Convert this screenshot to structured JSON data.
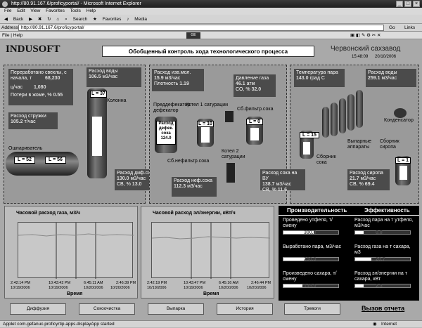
{
  "window": {
    "title": "http://80.91.167.6/proficyportal/ - Microsoft Internet Explorer"
  },
  "menu": [
    "File",
    "Edit",
    "View",
    "Favorites",
    "Tools",
    "Help"
  ],
  "toolbar": {
    "back": "Back",
    "search": "Search",
    "favorites": "Favorites",
    "media": "Media"
  },
  "address": {
    "label": "Address",
    "value": "http://80.91.167.6/proficyportal/",
    "go": "Go",
    "links": "Links"
  },
  "appmenu": {
    "file_help": "File | Help"
  },
  "header": {
    "logo": "INDUSOFT",
    "title": "Обобщенный контроль хода технологического процесса",
    "plant": "Червонский сахзавод",
    "time": "15:48:09",
    "date": "20/10/2006"
  },
  "left_panel": {
    "processed_label": "Переработано свеклы, с начала, т",
    "processed_value": "68,230",
    "perhour_label": "ц/час",
    "perhour_value": "1,080",
    "loss_label": "Потери в жоме, %",
    "loss_value": "0.55",
    "chips_label": "Расход стружки",
    "chips_value": "105.2",
    "chips_unit": "т/час",
    "water_label": "Расход воды",
    "water_value": "106.5",
    "water_unit": "м3/час",
    "column_label": "Колонна",
    "column_level": "L = 37",
    "scalder_label": "Ошпариватель",
    "scalder_l1": "L = 52",
    "scalder_l2": "L = 56",
    "diff_label": "Расход диф.сока",
    "diff_value": "130.0",
    "diff_unit": "м3/час",
    "sv_label": "СВ, %",
    "sv_value": "13.0"
  },
  "mid_panel": {
    "lime_label": "Расход изв.мол.",
    "lime_value": "15.9",
    "lime_unit": "м3/час",
    "density_label": "Плотность",
    "density_value": "1.19",
    "gas_label": "Давление газа",
    "gas_value": "46.1",
    "gas_unit": "атм",
    "co_label": "CO, %",
    "co_value": "32.0",
    "predef_label": "Преддефекатор дефекатор",
    "defek_tank_label": "Расход дефек. сока",
    "defek_tank_value": "124.0",
    "sat1_label": "Котел 1 сатурации",
    "sb_filtr_label": "Сб.фильтр.сока",
    "sb_nefilt_label": "Сб.нефильтр.сока",
    "sat2_label": "Котел 2 сатурации",
    "l10": "L = 10",
    "l0": "L = 0",
    "nef_label": "Расход неф.сока",
    "nef_value": "112.3",
    "nef_unit": "м3/час"
  },
  "right_panel": {
    "steam_temp_label": "Температура пара",
    "steam_temp_value": "143.0",
    "steam_temp_unit": "град С",
    "water2_label": "Расход воды",
    "water2_value": "259.1",
    "water2_unit": "м3/час",
    "condenser_label": "Конденсатор",
    "evap_label": "Выпарные аппараты",
    "sok_label": "Сборник сока",
    "sok_level": "L = 15",
    "syrup_coll_label": "Сборник сиропа",
    "syrup_level": "L = 1",
    "vu_label": "Расход сока на ВУ",
    "vu_value": "138.7",
    "vu_unit": "м3/час",
    "sv2_label": "СВ, %",
    "sv2_value": "11.6",
    "syrup_label": "Расход сиропа",
    "syrup_value": "21.7",
    "syrup_unit": "м3/час",
    "sv3_label": "СВ, %",
    "sv3_value": "69.4"
  },
  "trend1": {
    "title": "Часовой расход газа, м3/ч",
    "times": [
      "2:42:14 PM",
      "10:43:42 PM",
      "6:45:11 AM",
      "2:46:39 PM"
    ],
    "dates": [
      "10/19/2006",
      "10/19/2006",
      "10/20/2006",
      "10/20/2006"
    ],
    "axis": "Время"
  },
  "trend2": {
    "title": "Часовой расход эл/энергии, кВт/ч",
    "times": [
      "2:42:19 PM",
      "10:43:47 PM",
      "6:45:16 AM",
      "2:46:44 PM"
    ],
    "dates": [
      "10/19/2006",
      "10/19/2006",
      "10/20/2006",
      "10/20/2006"
    ],
    "axis": "Время"
  },
  "perf": {
    "title_prod": "Производительность",
    "title_eff": "Эффективность",
    "rows_left": [
      {
        "label": "Проведено утфеля, т/смену",
        "value": "300.0",
        "fill": 0.55
      },
      {
        "label": "Выработано пара, м3/час",
        "value": "250.0",
        "fill": 0.4
      },
      {
        "label": "Произведено сахара, т/смену",
        "value": "145.0",
        "fill": 0.35
      }
    ],
    "rows_right": [
      {
        "label": "Расход пара на т утфеля, м3/час",
        "value": "0.8",
        "fill": 0.15
      },
      {
        "label": "Расход газа на т сахара, м3",
        "value": "20.7",
        "fill": 0.3
      },
      {
        "label": "Расход эл/энергии на т сахара, кВт",
        "value": "2.3",
        "fill": 0.15
      }
    ]
  },
  "buttons": [
    "Диффузия",
    "Сокоочистка",
    "Выпарка",
    "История",
    "Тревоги"
  ],
  "report_link": "Вызов отчета",
  "status": {
    "left": "Applet com.gefanuc.proficyrtip.apps.displayApp started",
    "right": "Internet"
  }
}
